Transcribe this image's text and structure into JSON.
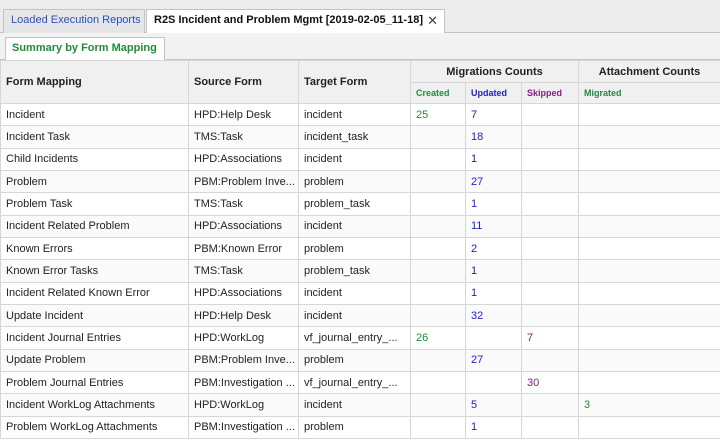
{
  "tabs": [
    {
      "label": "Loaded Execution Reports"
    },
    {
      "label": "R2S Incident and Problem Mgmt [2019-02-05_11-18]",
      "close": "✕"
    }
  ],
  "subtab": {
    "label": "Summary by Form Mapping"
  },
  "columns": {
    "form_mapping": "Form Mapping",
    "source_form": "Source Form",
    "target_form": "Target Form",
    "migrations_group": "Migrations Counts",
    "attachments_group": "Attachment Counts",
    "created": "Created",
    "updated": "Updated",
    "skipped": "Skipped",
    "migrated": "Migrated"
  },
  "rows": [
    {
      "mapping": "Incident",
      "source": "HPD:Help Desk",
      "target": "incident",
      "created": "25",
      "updated": "7",
      "skipped": "",
      "migrated": ""
    },
    {
      "mapping": "Incident Task",
      "source": "TMS:Task",
      "target": "incident_task",
      "created": "",
      "updated": "18",
      "skipped": "",
      "migrated": ""
    },
    {
      "mapping": "Child Incidents",
      "source": "HPD:Associations",
      "target": "incident",
      "created": "",
      "updated": "1",
      "skipped": "",
      "migrated": ""
    },
    {
      "mapping": "Problem",
      "source": "PBM:Problem Inve...",
      "target": "problem",
      "created": "",
      "updated": "27",
      "skipped": "",
      "migrated": ""
    },
    {
      "mapping": "Problem Task",
      "source": "TMS:Task",
      "target": "problem_task",
      "created": "",
      "updated": "1",
      "skipped": "",
      "migrated": ""
    },
    {
      "mapping": "Incident Related Problem",
      "source": "HPD:Associations",
      "target": "incident",
      "created": "",
      "updated": "11",
      "skipped": "",
      "migrated": ""
    },
    {
      "mapping": "Known Errors",
      "source": "PBM:Known Error",
      "target": "problem",
      "created": "",
      "updated": "2",
      "skipped": "",
      "migrated": ""
    },
    {
      "mapping": "Known Error Tasks",
      "source": "TMS:Task",
      "target": "problem_task",
      "created": "",
      "updated": "1",
      "skipped": "",
      "migrated": ""
    },
    {
      "mapping": "Incident Related Known Error",
      "source": "HPD:Associations",
      "target": "incident",
      "created": "",
      "updated": "1",
      "skipped": "",
      "migrated": ""
    },
    {
      "mapping": "Update Incident",
      "source": "HPD:Help Desk",
      "target": "incident",
      "created": "",
      "updated": "32",
      "skipped": "",
      "migrated": ""
    },
    {
      "mapping": "Incident Journal Entries",
      "source": "HPD:WorkLog",
      "target": "vf_journal_entry_...",
      "created": "26",
      "updated": "",
      "skipped": "7",
      "migrated": ""
    },
    {
      "mapping": "Update Problem",
      "source": "PBM:Problem Inve...",
      "target": "problem",
      "created": "",
      "updated": "27",
      "skipped": "",
      "migrated": ""
    },
    {
      "mapping": "Problem Journal Entries",
      "source": "PBM:Investigation ...",
      "target": "vf_journal_entry_...",
      "created": "",
      "updated": "",
      "skipped": "30",
      "migrated": ""
    },
    {
      "mapping": "Incident WorkLog Attachments",
      "source": "HPD:WorkLog",
      "target": "incident",
      "created": "",
      "updated": "5",
      "skipped": "",
      "migrated": "3"
    },
    {
      "mapping": "Problem WorkLog Attachments",
      "source": "PBM:Investigation ...",
      "target": "problem",
      "created": "",
      "updated": "1",
      "skipped": "",
      "migrated": ""
    }
  ]
}
